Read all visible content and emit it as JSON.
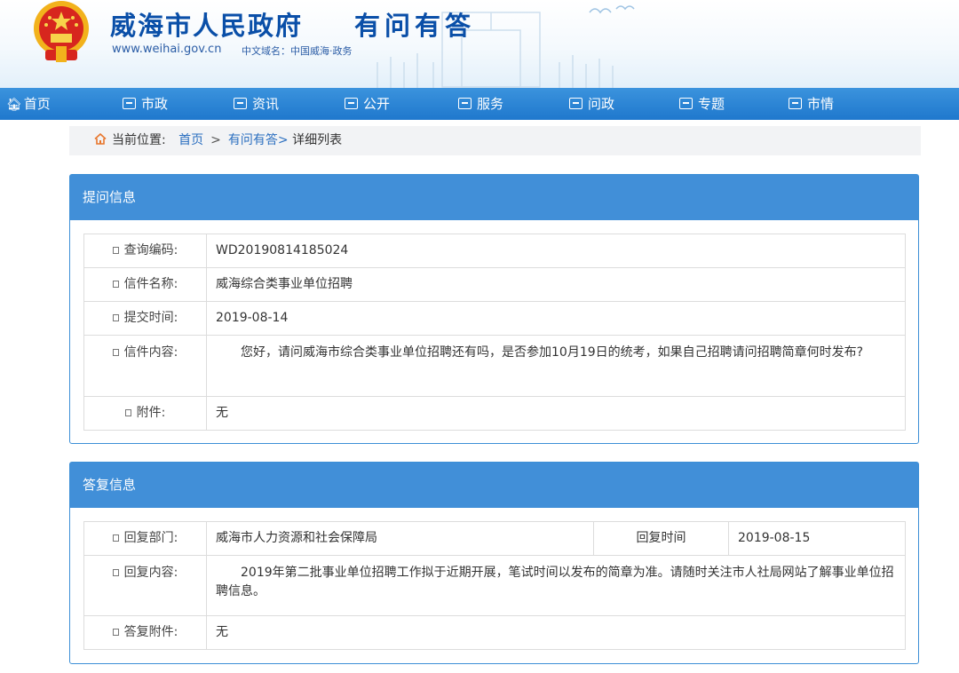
{
  "header": {
    "title": "威海市人民政府",
    "subtitle": "有问有答",
    "url": "www.weihai.gov.cn",
    "domain": "中文域名：中国威海·政务"
  },
  "nav": {
    "items": [
      {
        "label": "首页",
        "icon": "home-icon"
      },
      {
        "label": "市政",
        "icon": "building-icon"
      },
      {
        "label": "资讯",
        "icon": "news-icon"
      },
      {
        "label": "公开",
        "icon": "book-icon"
      },
      {
        "label": "服务",
        "icon": "monitor-icon"
      },
      {
        "label": "问政",
        "icon": "monitor-icon"
      },
      {
        "label": "专题",
        "icon": "chat-icon"
      },
      {
        "label": "市情",
        "icon": "document-icon"
      }
    ]
  },
  "breadcrumb": {
    "prefix": "当前位置:",
    "home": "首页",
    "sep": ">",
    "section": "有问有答>",
    "current": "详细列表"
  },
  "question": {
    "heading": "提问信息",
    "rows": [
      {
        "label": "查询编码:",
        "value": "WD20190814185024"
      },
      {
        "label": "信件名称:",
        "value": "威海综合类事业单位招聘"
      },
      {
        "label": "提交时间:",
        "value": "2019-08-14"
      },
      {
        "label": "信件内容:",
        "value": "您好，请问威海市综合类事业单位招聘还有吗，是否参加10月19日的统考，如果自己招聘请问招聘简章何时发布?"
      },
      {
        "label": "附件:",
        "value": "无"
      }
    ]
  },
  "reply": {
    "heading": "答复信息",
    "dept_label": "回复部门:",
    "dept_value": "威海市人力资源和社会保障局",
    "time_label": "回复时间",
    "time_value": "2019-08-15",
    "content_label": "回复内容:",
    "content_value": "2019年第二批事业单位招聘工作拟于近期开展，笔试时间以发布的简章为准。请随时关注市人社局网站了解事业单位招聘信息。",
    "attach_label": "答复附件:",
    "attach_value": "无"
  },
  "colors": {
    "brand_blue": "#0a4fa8",
    "nav_blue": "#1f78cd",
    "panel_head": "#418fd8",
    "link": "#2b6fc0"
  }
}
